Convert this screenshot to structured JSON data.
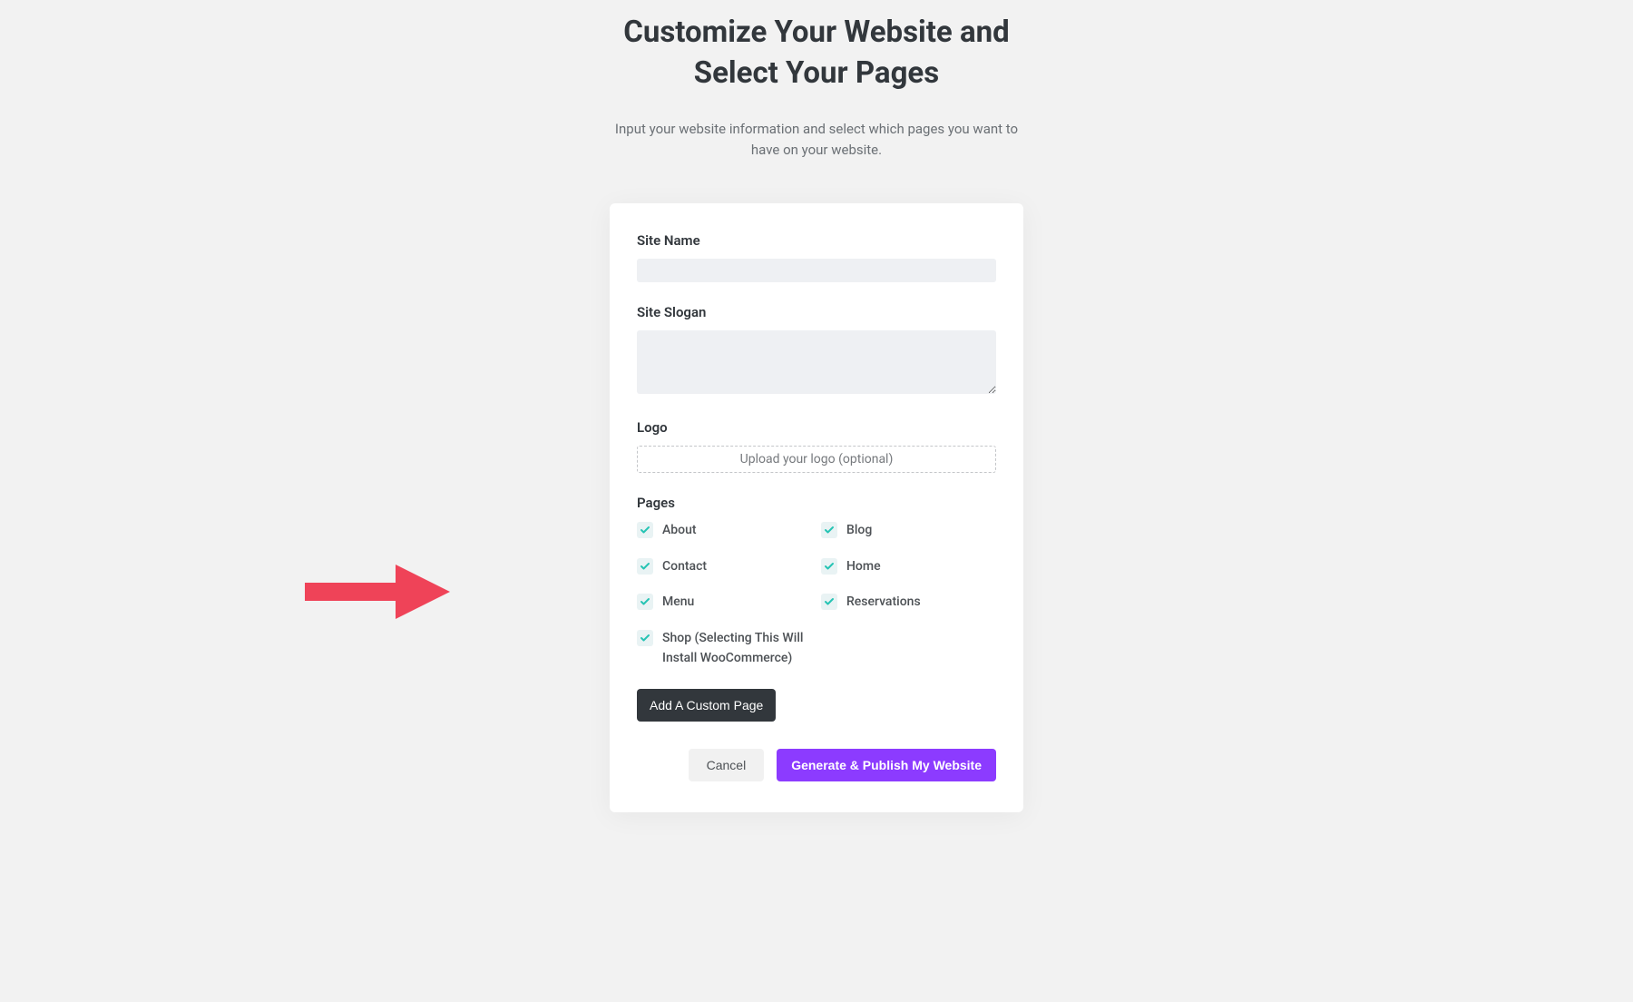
{
  "header": {
    "title": "Customize Your Website and Select Your Pages",
    "subtitle": "Input your website information and select which pages you want to have on your website."
  },
  "form": {
    "site_name": {
      "label": "Site Name",
      "value": ""
    },
    "site_slogan": {
      "label": "Site Slogan",
      "value": ""
    },
    "logo": {
      "label": "Logo",
      "upload_text": "Upload your logo (optional)"
    },
    "pages": {
      "label": "Pages",
      "items": [
        {
          "label": "About",
          "checked": true
        },
        {
          "label": "Blog",
          "checked": true
        },
        {
          "label": "Contact",
          "checked": true
        },
        {
          "label": "Home",
          "checked": true
        },
        {
          "label": "Menu",
          "checked": true
        },
        {
          "label": "Reservations",
          "checked": true
        },
        {
          "label": "Shop (Selecting This Will Install WooCommerce)",
          "checked": true
        }
      ]
    },
    "add_custom_label": "Add A Custom Page",
    "cancel_label": "Cancel",
    "generate_label": "Generate & Publish My Website"
  },
  "colors": {
    "accent_purple": "#8c3bff",
    "check_teal": "#26c4b4",
    "arrow_red": "#ef4358"
  }
}
